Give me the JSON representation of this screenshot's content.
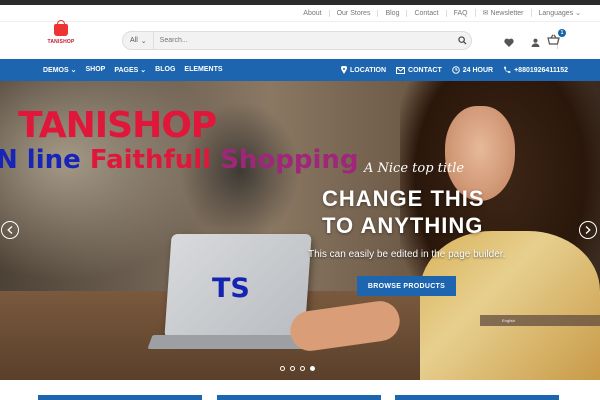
{
  "topbar": {
    "links": [
      "About",
      "Our Stores",
      "Blog",
      "Contact",
      "FAQ",
      "Newsletter",
      "Languages"
    ]
  },
  "header": {
    "logo_name": "TANISHOP",
    "search": {
      "category": "All",
      "placeholder": "Search..."
    },
    "cart_count": "1"
  },
  "nav": {
    "left": [
      "DEMOS",
      "SHOP",
      "PAGES",
      "BLOG",
      "ELEMENTS"
    ],
    "right": {
      "location": "LOCATION",
      "contact": "CONTACT",
      "hours": "24 HOUR",
      "phone": "+8801926411152"
    }
  },
  "hero": {
    "brand_title": "TANISHOP",
    "brand_tagline_1": "N line ",
    "brand_tagline_2": "Faithfull ",
    "brand_tagline_3": "Shopping",
    "laptop_text": "TS",
    "subtitle": "A Nice top title",
    "headline_1": "CHANGE THIS",
    "headline_2": "TO ANYTHING",
    "description": "This can easily be edited in the page builder.",
    "cta": "BROWSE PRODUCTS",
    "slides_total": 4,
    "active_slide": 4
  },
  "colors": {
    "primary": "#1d65af",
    "brand_red": "#e0163a",
    "brand_blue": "#1624b8"
  }
}
